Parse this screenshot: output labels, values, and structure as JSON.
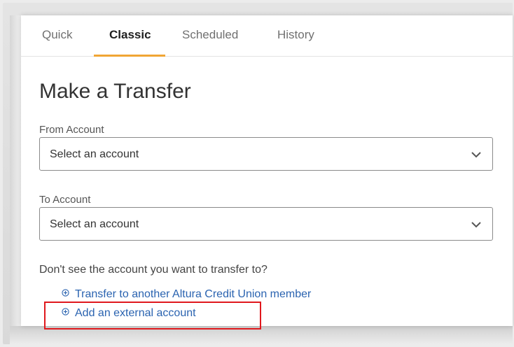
{
  "tabs": [
    {
      "label": "Quick",
      "active": false
    },
    {
      "label": "Classic",
      "active": true
    },
    {
      "label": "Scheduled",
      "active": false
    },
    {
      "label": "History",
      "active": false
    }
  ],
  "form": {
    "title": "Make a Transfer",
    "from_account": {
      "label": "From Account",
      "value": "Select an account"
    },
    "to_account": {
      "label": "To Account",
      "value": "Select an account"
    },
    "help_text": "Don't see the account you want to transfer to?",
    "links": [
      {
        "label": "Transfer to another Altura Credit Union member",
        "icon": "plus-circle-icon"
      },
      {
        "label": "Add an external account",
        "icon": "plus-circle-icon",
        "highlighted": true
      }
    ]
  },
  "colors": {
    "accent_tab_underline": "#f0a534",
    "link": "#2a63b0",
    "highlight_border": "#e0181d"
  }
}
